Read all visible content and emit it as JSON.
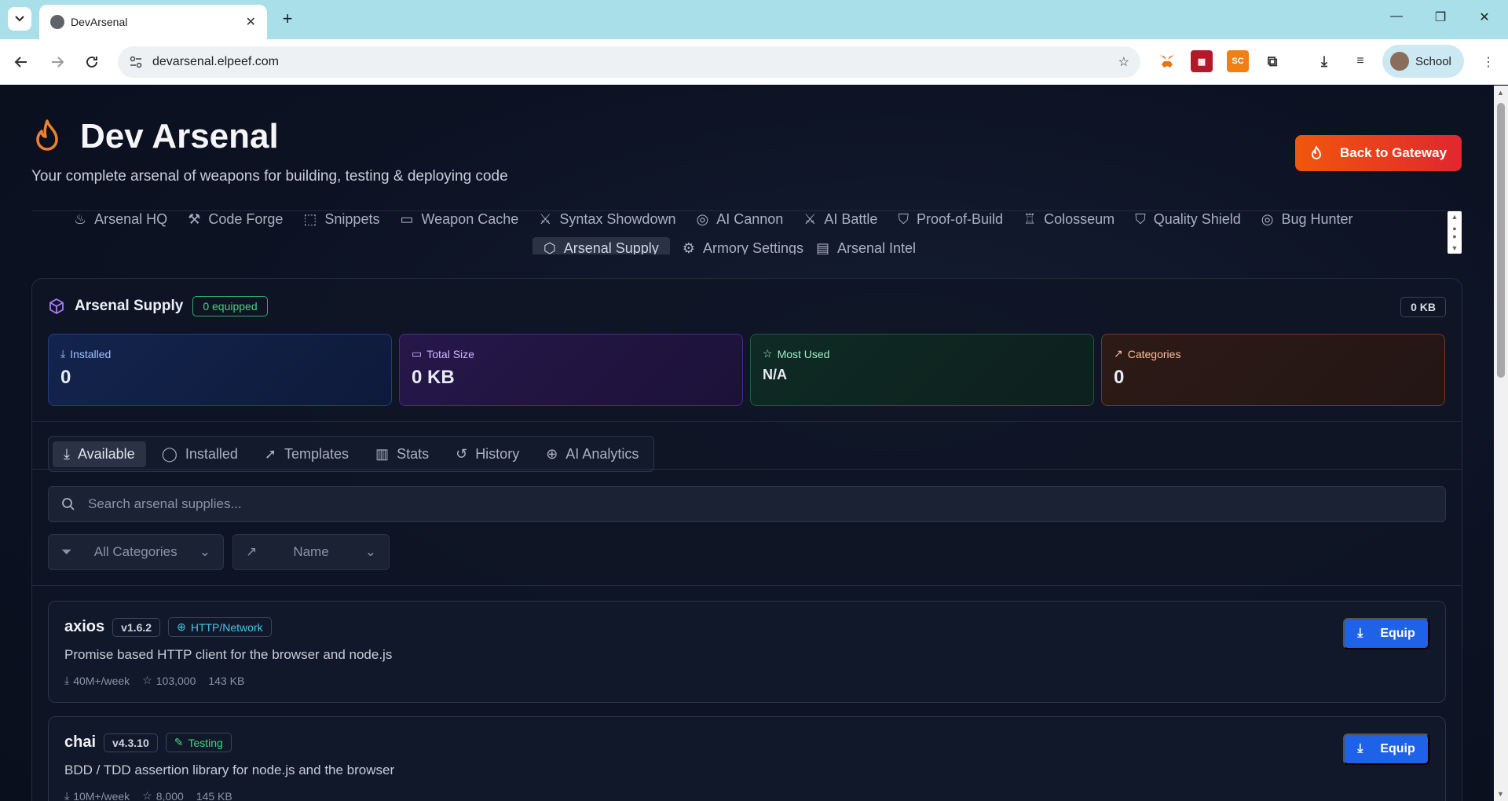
{
  "browser": {
    "tab_title": "DevArsenal",
    "url": "devarsenal.elpeef.com",
    "profile_label": "School"
  },
  "header": {
    "title": "Dev Arsenal",
    "subtitle": "Your complete arsenal of weapons for building, testing & deploying code",
    "back_button": "Back to Gateway"
  },
  "nav": {
    "row1": [
      "Arsenal HQ",
      "Code Forge",
      "Snippets",
      "Weapon Cache",
      "Syntax Showdown",
      "AI Cannon",
      "AI Battle",
      "Proof-of-Build",
      "Colosseum",
      "Quality Shield",
      "Bug Hunter"
    ],
    "row2": [
      "Arsenal Supply",
      "Armory Settings",
      "Arsenal Intel"
    ],
    "active": "Arsenal Supply"
  },
  "panel": {
    "title": "Arsenal Supply",
    "equipped_badge": "0 equipped",
    "size_badge": "0 KB",
    "stats": [
      {
        "label": "Installed",
        "value": "0"
      },
      {
        "label": "Total Size",
        "value": "0 KB"
      },
      {
        "label": "Most Used",
        "value": "N/A"
      },
      {
        "label": "Categories",
        "value": "0"
      }
    ],
    "subtabs": [
      "Available",
      "Installed",
      "Templates",
      "Stats",
      "History",
      "AI Analytics"
    ],
    "active_subtab": "Available",
    "search_placeholder": "Search arsenal supplies...",
    "category_select": "All Categories",
    "sort_select": "Name",
    "packages": [
      {
        "name": "axios",
        "version": "v1.6.2",
        "category": "HTTP/Network",
        "description": "Promise based HTTP client for the browser and node.js",
        "downloads": "40M+/week",
        "stars": "103,000",
        "size": "143 KB",
        "action": "Equip"
      },
      {
        "name": "chai",
        "version": "v4.3.10",
        "category": "Testing",
        "description": "BDD / TDD assertion library for node.js and the browser",
        "downloads": "10M+/week",
        "stars": "8,000",
        "size": "145 KB",
        "action": "Equip"
      }
    ]
  },
  "colors": {
    "accent_orange": "#f0570c",
    "equip_blue": "#1e62e8",
    "badge_green": "#42d47f",
    "http_cyan": "#4cc3e6"
  }
}
